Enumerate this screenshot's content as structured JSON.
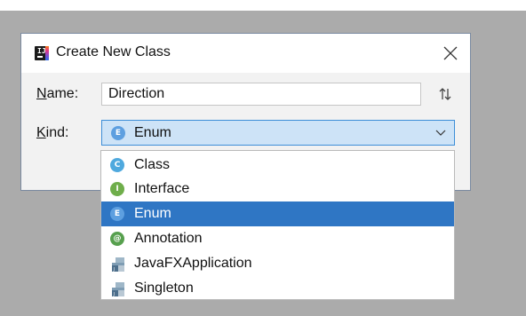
{
  "dialog": {
    "title": "Create New Class",
    "name_label": "Name:",
    "name_value": "Direction",
    "kind_label": "Kind:",
    "kind_selected": {
      "label": "Enum",
      "badge": "E"
    }
  },
  "dropdown": {
    "items": [
      {
        "label": "Class",
        "icon": "class-icon",
        "badge": "C",
        "selected": false
      },
      {
        "label": "Interface",
        "icon": "interface-icon",
        "badge": "I",
        "selected": false
      },
      {
        "label": "Enum",
        "icon": "enum-icon",
        "badge": "E",
        "selected": true
      },
      {
        "label": "Annotation",
        "icon": "annotation-icon",
        "badge": "@",
        "selected": false
      },
      {
        "label": "JavaFXApplication",
        "icon": "javafx-file-icon",
        "badge": "",
        "selected": false
      },
      {
        "label": "Singleton",
        "icon": "singleton-file-icon",
        "badge": "",
        "selected": false
      }
    ]
  },
  "colors": {
    "selection": "#2f76c4",
    "combo_focus": "#cde3f7",
    "enum_badge": "#5d9fe0",
    "class_badge": "#4fa9de",
    "interface_badge": "#6fae4b",
    "annotation_badge": "#57a04e"
  }
}
